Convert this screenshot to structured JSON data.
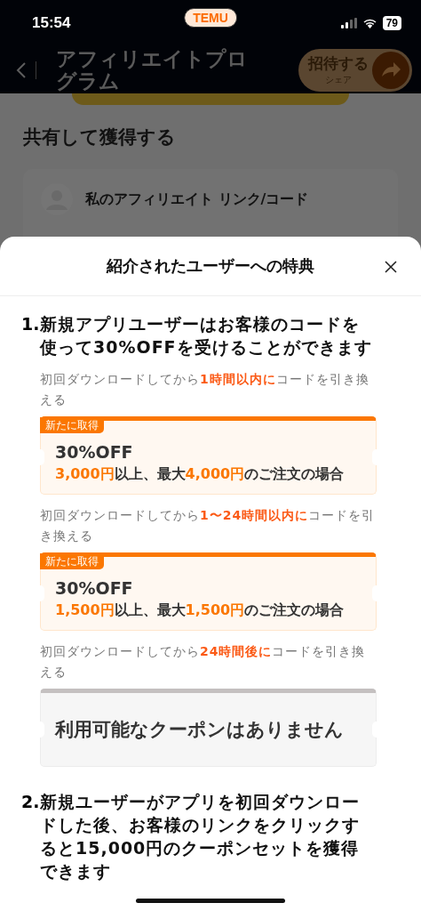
{
  "status_bar": {
    "time": "15:54",
    "app_badge": "TEMU",
    "battery": "79"
  },
  "header": {
    "title": "アフィリエイトプログラム",
    "invite_button": {
      "label": "招待する",
      "sublabel": "シェア"
    }
  },
  "background": {
    "section_title": "共有して獲得する",
    "card_title": "私のアフィリエイト リンク/コード"
  },
  "sheet": {
    "title": "紹介されたユーザーへの特典",
    "items": [
      {
        "number": "1.",
        "heading": "新規アプリユーザーはお客様のコードを使って30%OFFを受けることができます",
        "tiers": [
          {
            "note": "初回ダウンロードしてから**1時間以内に**コードを引き換える",
            "coupon": {
              "kind": "offer",
              "tag": "新たに取得",
              "title": "30%OFF",
              "condition": "**3,000円**以上、最大**4,000円**のご注文の場合"
            }
          },
          {
            "note": "初回ダウンロードしてから**1〜24時間以内に**コードを引き換える",
            "coupon": {
              "kind": "offer",
              "tag": "新たに取得",
              "title": "30%OFF",
              "condition": "**1,500円**以上、最大**1,500円**のご注文の場合"
            }
          },
          {
            "note": "初回ダウンロードしてから**24時間後に**コードを引き換える",
            "coupon": {
              "kind": "empty",
              "title": "利用可能なクーポンはありません"
            }
          }
        ]
      },
      {
        "number": "2.",
        "heading": "新規ユーザーがアプリを初回ダウンロードした後、お客様のリンクをクリックすると15,000円のクーポンセットを獲得できます"
      }
    ]
  }
}
